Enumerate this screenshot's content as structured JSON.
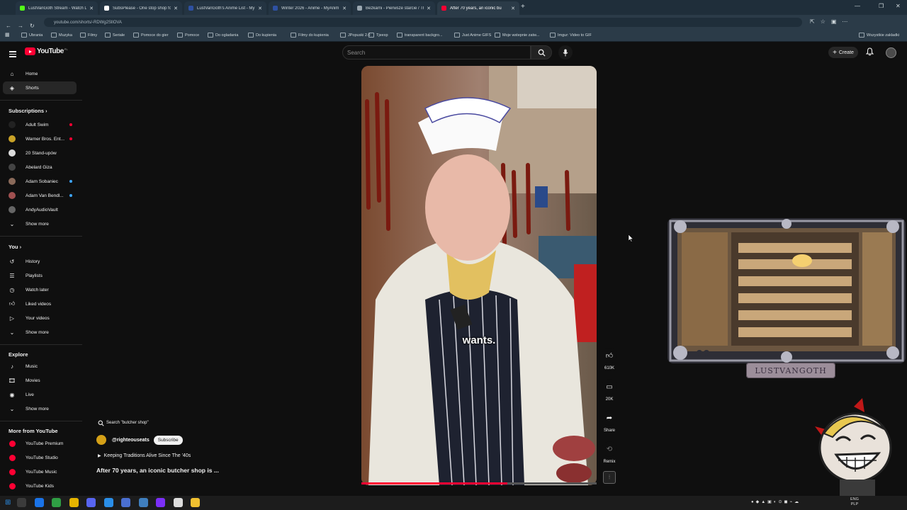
{
  "browser": {
    "tabs": [
      {
        "label": "LustVanGoth Stream - Watch L",
        "color": "#53fc18",
        "active": false
      },
      {
        "label": "SubsPlease - One stop shop fo",
        "color": "#ffffff",
        "active": false
      },
      {
        "label": "LustVanGoth's Anime List - My",
        "color": "#2e51a2",
        "active": false
      },
      {
        "label": "Winter 2026 - Anime - MyAnim",
        "color": "#2e51a2",
        "active": false
      },
      {
        "label": "Bezkarni - Pierwsze starcie / Th",
        "color": "#9aa7b0",
        "active": false
      },
      {
        "label": "After 70 years, an iconic bu",
        "color": "#ff0033",
        "active": true
      }
    ],
    "url": "youtube.com/shorts/-RDWg2SllOVA",
    "bookmarks": [
      "Ubrania",
      "Muzyka",
      "Filmy",
      "Seriale",
      "Pomoce do gier",
      "Pomoce",
      "Do ogladania",
      "Do kupienia",
      "Filmy do kupienia",
      "JPopuski 2.0",
      "Tjeexp",
      "transparent backgro...",
      "Just Anime GIFS",
      "Moje wstepnie zatw...",
      "Imgur: Video to GIF"
    ],
    "all_bookmarks": "Wszystkie zakladki"
  },
  "header": {
    "logo": "YouTube",
    "region": "PL",
    "search_placeholder": "Search",
    "create_label": "Create"
  },
  "sidebar": {
    "main": [
      {
        "label": "Home",
        "icon": "home-icon"
      },
      {
        "label": "Shorts",
        "icon": "shorts-icon",
        "active": true
      }
    ],
    "subscriptions_title": "Subscriptions",
    "subscriptions": [
      {
        "label": "Adult Swim",
        "dot": "live",
        "avatar_color": "#222222"
      },
      {
        "label": "Warner Bros. Ent...",
        "dot": "live",
        "avatar_color": "#c9a227"
      },
      {
        "label": "20 Stand-upów",
        "dot": "",
        "avatar_color": "#dddddd"
      },
      {
        "label": "Abelard Giza",
        "dot": "",
        "avatar_color": "#444444"
      },
      {
        "label": "Adam Sobaniec",
        "dot": "new",
        "avatar_color": "#8a6a5a"
      },
      {
        "label": "Adam Van Bendl...",
        "dot": "new",
        "avatar_color": "#a05050"
      },
      {
        "label": "AndyAudioVault",
        "dot": "",
        "avatar_color": "#666666"
      }
    ],
    "show_more": "Show more",
    "you_title": "You",
    "you": [
      {
        "label": "History",
        "icon": "history-icon"
      },
      {
        "label": "Playlists",
        "icon": "playlists-icon"
      },
      {
        "label": "Watch later",
        "icon": "watch-later-icon"
      },
      {
        "label": "Liked videos",
        "icon": "liked-videos-icon"
      },
      {
        "label": "Your videos",
        "icon": "your-videos-icon"
      }
    ],
    "explore_title": "Explore",
    "explore": [
      {
        "label": "Music",
        "icon": "music-icon"
      },
      {
        "label": "Movies",
        "icon": "movies-icon"
      },
      {
        "label": "Live",
        "icon": "live-icon"
      }
    ],
    "more_title": "More from YouTube",
    "more": [
      {
        "label": "YouTube Premium"
      },
      {
        "label": "YouTube Studio"
      },
      {
        "label": "YouTube Music"
      },
      {
        "label": "YouTube Kids"
      }
    ]
  },
  "short": {
    "caption": "wants.",
    "search_chip": "Search \"butcher shop\"",
    "channel": "@righteouseats",
    "subscribe": "Subscribe",
    "playlist": "Keeping Traditions Alive Since The '40s",
    "title": "After 70 years, an iconic butcher shop is ...",
    "progress_fraction": 0.62,
    "likes": "610K",
    "comments": "20K",
    "share": "Share",
    "remix": "Remix"
  },
  "overlay": {
    "plate_text": "LUSTVANGOTH"
  },
  "taskbar": {
    "lang_top": "ENG",
    "lang_bottom": "PLP"
  }
}
